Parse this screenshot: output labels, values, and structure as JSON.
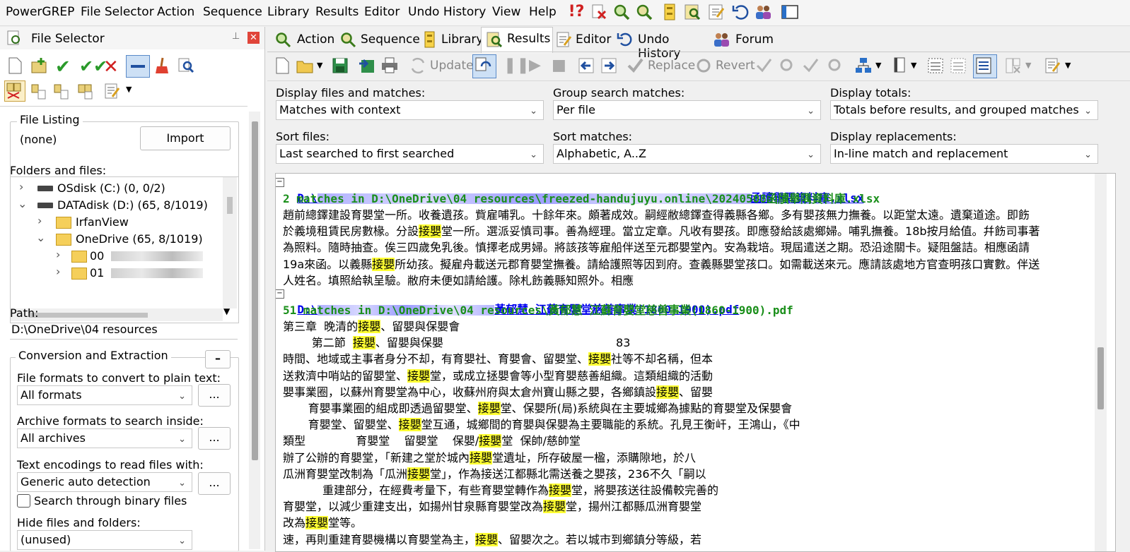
{
  "menu": [
    "PowerGREP",
    "File Selector",
    "Action",
    "Sequence",
    "Library",
    "Results",
    "Editor",
    "Undo History",
    "View",
    "Help"
  ],
  "left_panel": {
    "title": "File Selector",
    "file_listing": {
      "label": "File Listing",
      "value": "(none)",
      "import_button": "Import"
    },
    "folders_label": "Folders and files:",
    "tree": [
      {
        "name": "OSdisk (C:) (0, 0/2)"
      },
      {
        "name": "DATAdisk (D:) (65, 8/1019)"
      },
      {
        "name": "IrfanView"
      },
      {
        "name": "OneDrive (65, 8/1019)"
      },
      {
        "name": "00"
      },
      {
        "name": "01"
      }
    ],
    "path_label": "Path:",
    "path_value": "D:\\OneDrive\\04 resources",
    "conversion": {
      "title": "Conversion and Extraction",
      "collapse_btn": "–",
      "formats_label": "File formats to convert to plain text:",
      "formats_value": "All formats",
      "archives_label": "Archive formats to search inside:",
      "archives_value": "All archives",
      "encodings_label": "Text encodings to read files with:",
      "encodings_value": "Generic auto detection",
      "binary_label": "Search through binary files",
      "hide_label": "Hide files and folders:",
      "hide_value": "(unused)",
      "ellipsis": "..."
    }
  },
  "tabs": [
    "Action",
    "Sequence",
    "Library",
    "Results",
    "Editor",
    "Undo History",
    "Forum"
  ],
  "active_tab": "Results",
  "toolbar": {
    "update": "Update",
    "replace": "Replace",
    "revert": "Revert"
  },
  "options": {
    "display_files_label": "Display files and matches:",
    "display_files_value": "Matches with context",
    "group_label": "Group search matches:",
    "group_value": "Per file",
    "totals_label": "Display totals:",
    "totals_value": "Totals before results, and grouped matches",
    "sort_files_label": "Sort files:",
    "sort_files_value": "Last searched to first searched",
    "sort_matches_label": "Sort matches:",
    "sort_matches_value": "Alphabetic, A..Z",
    "replacements_label": "Display replacements:",
    "replacements_value": "In-line match and replacement"
  },
  "results": {
    "file1": {
      "path_start": "D:\\",
      "path_end": "函牘舉隅資料庫.xlsx",
      "matches": "2 matches in D:\\OneDrive\\04 resources\\freezed-handujuyu.online\\20240508函牘舉隅資料庫.xlsx"
    },
    "file1_lines": [
      [
        "趙前總鐸建設育嬰堂一所。收養遺孩。貲雇哺乳。十餘年來。頗著成效。嗣經敝總鐸查得義縣各鄉。多有嬰孩無力撫養。以距堂太遠。遺棄道途。即飭"
      ],
      [
        "於義境租賃民房數椽。分設",
        "接嬰",
        "堂一所。選派妥慎司事。善為經理。當立定章。凡收有嬰孩。即應發給該處鄉婦。哺乳撫養。18b按月給值。幷飭司事著"
      ],
      [
        "為照料。隨時抽查。俟三四歲免乳後。慎擇老成男婦。將該孩等雇船伴送至元郡嬰堂內。安為栽培。現屆遣送之期。恐沿途關卡。疑阻盤詰。相應函請"
      ],
      [
        "19a來函。以義縣",
        "接嬰",
        "所幼孩。擬雇舟載送元郡育嬰堂撫養。請給護照等因到府。查義縣嬰堂孩口。如需載送來元。應請該處地方官查明孩口實數。伴送"
      ],
      [
        "人姓名。填照給執呈驗。敝府未便如請給護。除札飭義縣知照外。相應"
      ]
    ],
    "file2": {
      "path_start": "D:\\",
      "path_end": "黃郁慧 江蘇育嬰堂慈善事業(1860-1900).pdf",
      "matches": "51 matches in D:\\OneDrive\\04 resources\\黃郁慧 江蘇育嬰堂慈善事業(1860-1900).pdf"
    },
    "file2_lines": [
      [
        "第三章  晚清的",
        "接嬰",
        "、留嬰與保嬰會"
      ],
      [
        "        第二節  ",
        "接嬰",
        "、留嬰與保嬰                                                83"
      ],
      [
        "時間、地域或主事者身分不却，有育嬰社、育嬰會、留嬰堂、",
        "接嬰",
        "社等不却名稱，但本"
      ],
      [
        "送救濟中哨站的留嬰堂、",
        "接嬰",
        "堂，或成立拯嬰會等小型育嬰慈善組織。這類組織的活動"
      ],
      [
        "嬰事業圈，以蘇州育嬰堂為中心，收蘇州府與太倉州寶山縣之嬰，各鄉鎮設",
        "接嬰",
        "、留嬰"
      ],
      [
        "       育嬰事業圈的組成即透過留嬰堂、",
        "接嬰",
        "堂、保嬰所(局)系統與在主要城鄉為據點的育嬰堂及保嬰會"
      ],
      [
        "       育嬰堂、留嬰堂、",
        "接嬰",
        "堂互通，城鄉間的育嬰與保嬰為主要職能的系統。孔見王衡屽，王鴻山，《中"
      ],
      [
        "類型              育嬰堂    留嬰堂    保嬰/",
        "接嬰",
        "堂  保帥/慈帥堂"
      ],
      [
        "辦了公辦的育嬰堂，「新建之堂於城內",
        "接嬰",
        "堂遺址，所存破屋一楹，添購隙地，於八"
      ],
      [
        "瓜洲育嬰堂改制為「瓜洲",
        "接嬰",
        "堂」，作為接送江都縣北需送養之嬰孩，236不久「嗣以"
      ],
      [
        "           重建部分，在經費考量下，有些育嬰堂轉作為",
        "接嬰",
        "堂，將嬰孩送往設備較完善的"
      ],
      [
        "育嬰堂，以減少重建支出，如揚州甘泉縣育嬰堂改為",
        "接嬰",
        "堂，揚州江都縣瓜洲育嬰堂"
      ],
      [
        "改為",
        "接嬰",
        "堂等。"
      ],
      [
        "速，再則重建育嬰機構以育嬰堂為主，",
        "接嬰",
        "、留嬰次之。若以城市到鄉鎮分等級，若"
      ]
    ]
  }
}
